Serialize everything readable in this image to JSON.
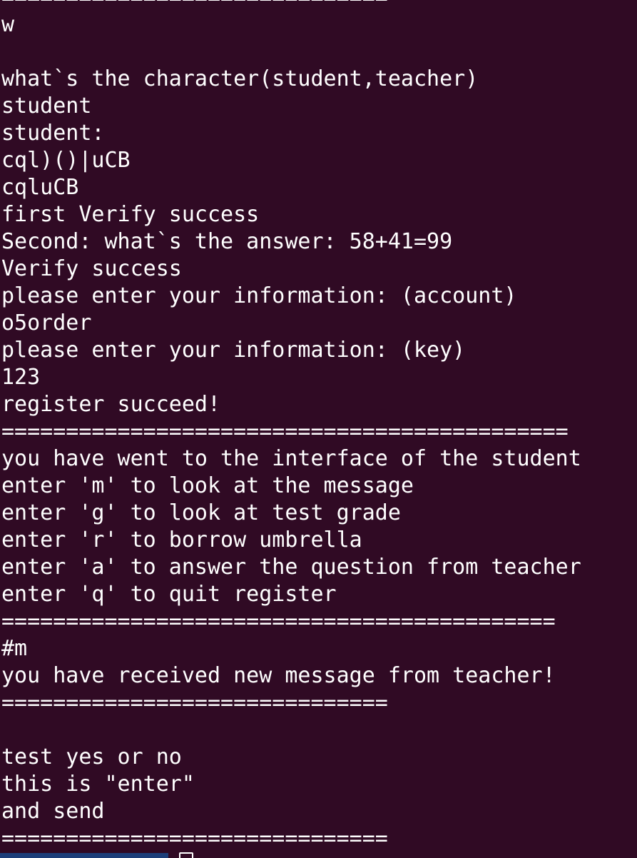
{
  "terminal": {
    "lines": [
      "==============================",
      "w",
      "",
      "what`s the character(student,teacher)",
      "student",
      "student:",
      "cql)()|uCB",
      "cqluCB",
      "first Verify success",
      "Second: what`s the answer: 58+41=99",
      "Verify success",
      "please enter your information: (account)",
      "o5order",
      "please enter your information: (key)",
      "123",
      "register succeed!",
      "============================================",
      "you have went to the interface of the student",
      "enter 'm' to look at the message",
      "enter 'g' to look at test grade",
      "enter 'r' to borrow umbrella",
      "enter 'a' to answer the question from teacher",
      "enter 'q' to quit register",
      "===========================================",
      "#m",
      "you have received new message from teacher!",
      "==============================",
      "",
      "test yes or no",
      "this is \"enter\"",
      "and send",
      "=============================="
    ]
  },
  "colors": {
    "background": "#300A24",
    "foreground": "#FFFFFF",
    "bottom_bar": "#1D3F7A"
  }
}
